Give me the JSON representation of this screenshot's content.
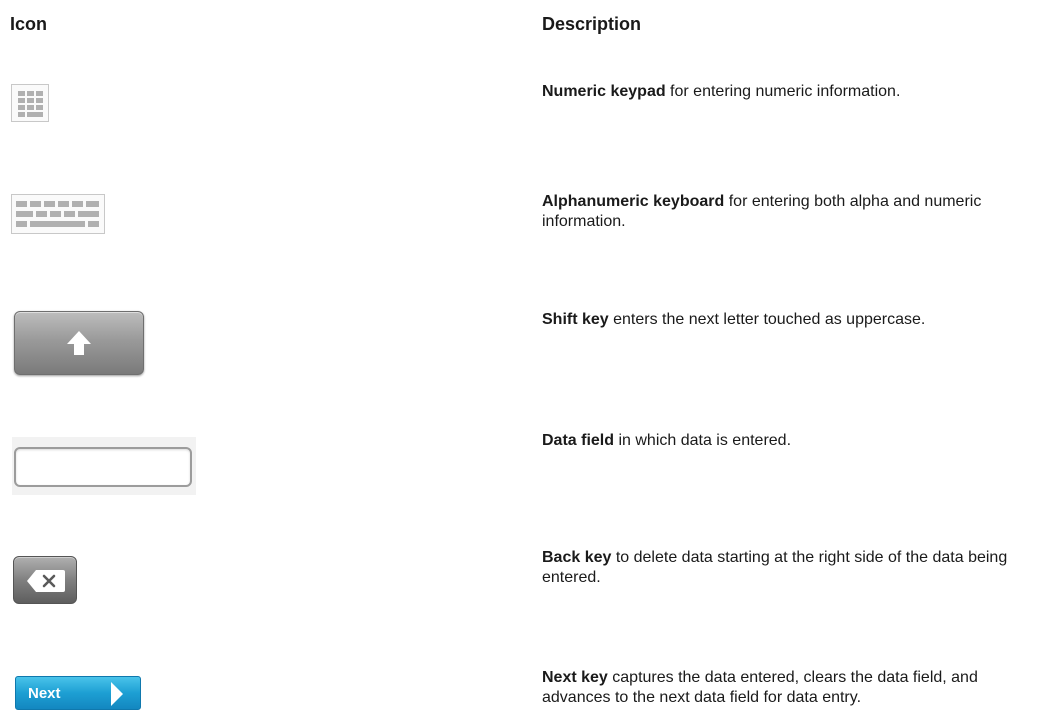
{
  "headers": {
    "icon": "Icon",
    "description": "Description"
  },
  "rows": [
    {
      "icon": "numeric-keypad-icon",
      "term": "Numeric keypad",
      "text": " for entering numeric information."
    },
    {
      "icon": "alphanumeric-keyboard-icon",
      "term": "Alphanumeric keyboard",
      "text": " for entering both alpha and numeric information."
    },
    {
      "icon": "shift-key-icon",
      "term": "Shift key",
      "text": " enters the next letter touched as uppercase."
    },
    {
      "icon": "data-field-icon",
      "term": "Data field",
      "text": " in which data is entered."
    },
    {
      "icon": "back-key-icon",
      "term": "Back key",
      "text": " to delete data starting at the right side of the data being entered."
    },
    {
      "icon": "next-key-icon",
      "term": "Next key",
      "text": " captures the data entered, clears the data field, and advances to the next data field for data entry."
    }
  ],
  "next_key_label": "Next",
  "colors": {
    "next_key_blue": "#1d9fd3",
    "key_gray": "#8a8a8a",
    "keypad_gray": "#b0b0b0"
  }
}
